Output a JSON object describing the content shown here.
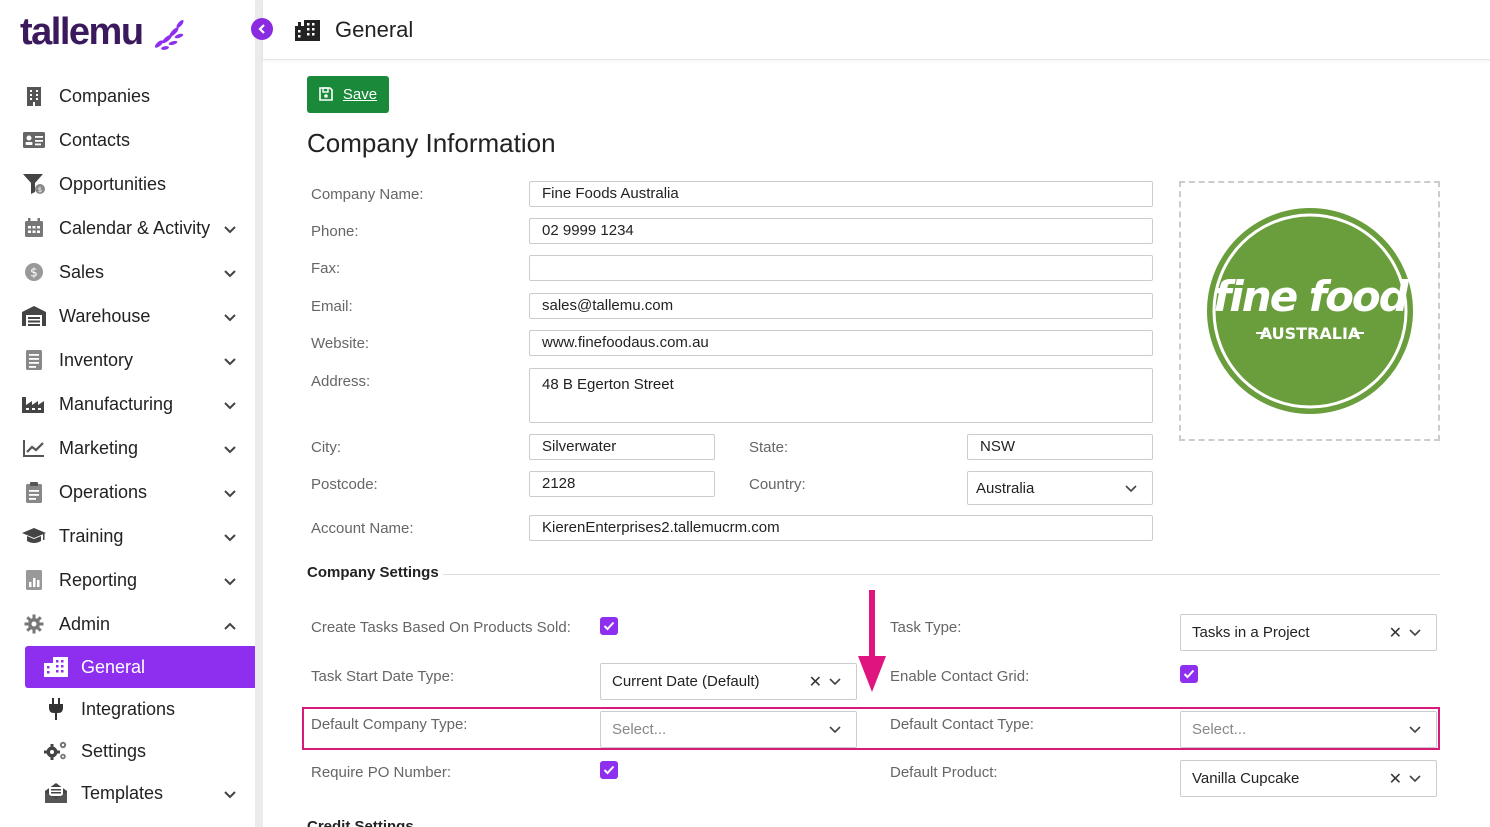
{
  "brand": {
    "logo_text": "tallemu",
    "accent": "#8e2ff0",
    "highlight": "#d81b7a",
    "save_green": "#1a8a3a"
  },
  "sidebar": {
    "items": [
      {
        "label": "Companies",
        "icon": "building-icon",
        "expandable": false
      },
      {
        "label": "Contacts",
        "icon": "contact-card-icon",
        "expandable": false
      },
      {
        "label": "Opportunities",
        "icon": "funnel-dollar-icon",
        "expandable": false
      },
      {
        "label": "Calendar & Activity",
        "icon": "calendar-icon",
        "expandable": true
      },
      {
        "label": "Sales",
        "icon": "dollar-circle-icon",
        "expandable": true
      },
      {
        "label": "Warehouse",
        "icon": "warehouse-icon",
        "expandable": true
      },
      {
        "label": "Inventory",
        "icon": "clipboard-list-icon",
        "expandable": true
      },
      {
        "label": "Manufacturing",
        "icon": "factory-icon",
        "expandable": true
      },
      {
        "label": "Marketing",
        "icon": "chart-line-icon",
        "expandable": true
      },
      {
        "label": "Operations",
        "icon": "clipboard-icon",
        "expandable": true
      },
      {
        "label": "Training",
        "icon": "graduation-cap-icon",
        "expandable": true
      },
      {
        "label": "Reporting",
        "icon": "report-icon",
        "expandable": true
      },
      {
        "label": "Admin",
        "icon": "gear-icon",
        "expandable": true,
        "expanded": true
      }
    ],
    "admin_sub": [
      {
        "label": "General",
        "icon": "building-icon",
        "active": true
      },
      {
        "label": "Integrations",
        "icon": "plug-icon",
        "active": false
      },
      {
        "label": "Settings",
        "icon": "gears-icon",
        "active": false
      },
      {
        "label": "Templates",
        "icon": "envelope-open-icon",
        "active": false,
        "expandable": true
      }
    ]
  },
  "header": {
    "title": "General"
  },
  "toolbar": {
    "save_label": "Save"
  },
  "company_info": {
    "title": "Company Information",
    "labels": {
      "name": "Company Name:",
      "phone": "Phone:",
      "fax": "Fax:",
      "email": "Email:",
      "website": "Website:",
      "address": "Address:",
      "city": "City:",
      "state": "State:",
      "postcode": "Postcode:",
      "country": "Country:",
      "account": "Account Name:"
    },
    "values": {
      "name": "Fine Foods Australia",
      "phone": "02 9999 1234",
      "fax": "",
      "email": "sales@tallemu.com",
      "website": "www.finefoodaus.com.au",
      "address": "48 B Egerton Street",
      "city": "Silverwater",
      "state": "NSW",
      "postcode": "2128",
      "country": "Australia",
      "account": "KierenEnterprises2.tallemucrm.com"
    },
    "logo": {
      "line1": "fine food",
      "line2": "AUSTRALIA",
      "color": "#6a9e3c"
    }
  },
  "company_settings": {
    "title": "Company Settings",
    "labels": {
      "create_tasks": "Create Tasks Based On Products Sold:",
      "task_type": "Task Type:",
      "task_start": "Task Start Date Type:",
      "enable_contact_grid": "Enable Contact Grid:",
      "default_company_type": "Default Company Type:",
      "default_contact_type": "Default Contact Type:",
      "require_po": "Require PO Number:",
      "default_product": "Default Product:"
    },
    "values": {
      "create_tasks": true,
      "task_type": "Tasks in a Project",
      "task_start": "Current Date (Default)",
      "enable_contact_grid": true,
      "default_company_type_placeholder": "Select...",
      "default_contact_type_placeholder": "Select...",
      "require_po": true,
      "default_product": "Vanilla Cupcake"
    }
  },
  "credit_settings": {
    "title": "Credit Settings"
  }
}
